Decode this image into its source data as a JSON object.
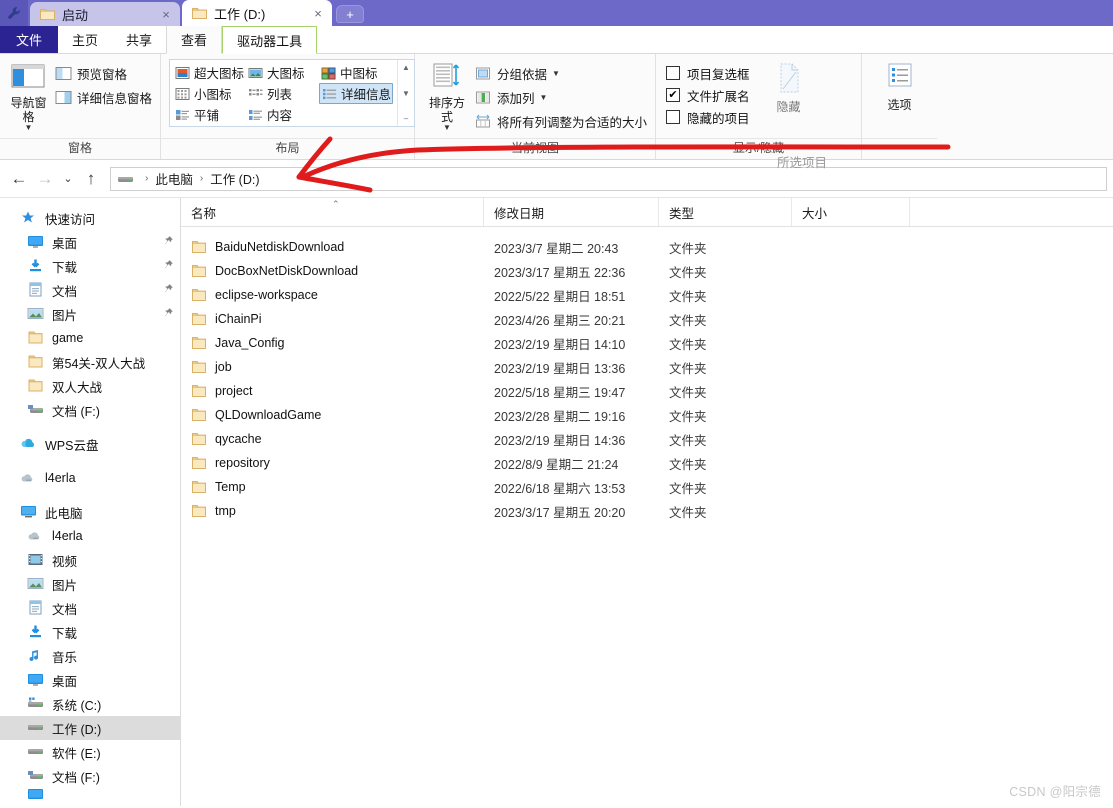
{
  "window": {
    "tabs": [
      {
        "label": "启动",
        "active": false,
        "icon": "folder-icon",
        "close": "×"
      },
      {
        "label": "工作 (D:)",
        "active": true,
        "icon": "folder-icon",
        "close": "×"
      }
    ],
    "new_tab_label": "+",
    "quick_access_icon": "wrench-icon"
  },
  "ribbon": {
    "tabs": [
      {
        "label": "文件",
        "kind": "file"
      },
      {
        "label": "主页",
        "kind": "normal"
      },
      {
        "label": "共享",
        "kind": "normal"
      },
      {
        "label": "查看",
        "kind": "selected"
      },
      {
        "label": "驱动器工具",
        "kind": "contextual"
      }
    ],
    "groups": [
      {
        "name": "窗格",
        "label": "窗格",
        "big_button": {
          "label": "导航窗格",
          "icon": "nav-pane-icon",
          "has_caret": true
        },
        "items": [
          {
            "label": "预览窗格",
            "icon": "preview-pane-icon"
          },
          {
            "label": "详细信息窗格",
            "icon": "details-pane-icon"
          }
        ]
      },
      {
        "name": "布局",
        "label": "布局",
        "views": [
          {
            "label": "超大图标",
            "icon": "extra-large-icons-icon",
            "selected": false
          },
          {
            "label": "大图标",
            "icon": "large-icons-icon",
            "selected": false
          },
          {
            "label": "中图标",
            "icon": "medium-icons-icon",
            "selected": false
          },
          {
            "label": "小图标",
            "icon": "small-icons-icon",
            "selected": false
          },
          {
            "label": "列表",
            "icon": "list-view-icon",
            "selected": false
          },
          {
            "label": "详细信息",
            "icon": "details-view-icon",
            "selected": true
          },
          {
            "label": "平铺",
            "icon": "tiles-view-icon",
            "selected": false
          },
          {
            "label": "内容",
            "icon": "content-view-icon",
            "selected": false
          }
        ],
        "scroll_up": "▲",
        "scroll_down": "▼",
        "scroll_more": "‒"
      },
      {
        "name": "当前视图",
        "label": "当前视图",
        "big_button": {
          "label": "排序方式",
          "icon": "sort-by-icon",
          "has_caret": true
        },
        "items": [
          {
            "label": "分组依据",
            "icon": "group-by-icon",
            "dropdown": true
          },
          {
            "label": "添加列",
            "icon": "add-columns-icon",
            "dropdown": true
          },
          {
            "label": "将所有列调整为合适的大小",
            "icon": "size-all-columns-icon",
            "dropdown": false
          }
        ]
      },
      {
        "name": "显示/隐藏",
        "label": "显示/隐藏",
        "checkboxes": [
          {
            "label": "项目复选框",
            "checked": false
          },
          {
            "label": "文件扩展名",
            "checked": true
          },
          {
            "label": "隐藏的项目",
            "checked": false
          }
        ],
        "hide_button": {
          "line1": "隐藏",
          "line2": "所选项目",
          "icon": "hide-selected-icon"
        }
      },
      {
        "name": "选项",
        "label": "",
        "big_button": {
          "label": "选项",
          "icon": "options-icon",
          "has_caret": false
        }
      }
    ]
  },
  "address": {
    "back_icon": "←",
    "forward_icon": "→",
    "recent_icon": "⌄",
    "up_icon": "↑",
    "drive_icon": "drive-icon",
    "crumbs": [
      "此电脑",
      "工作 (D:)"
    ],
    "separator": "›"
  },
  "nav_pane": {
    "sections": [
      {
        "header": {
          "label": "快速访问",
          "icon": "quick-access-star-icon",
          "level": "root"
        },
        "items": [
          {
            "label": "桌面",
            "icon": "desktop-icon",
            "pinned": true
          },
          {
            "label": "下载",
            "icon": "downloads-icon",
            "pinned": true
          },
          {
            "label": "文档",
            "icon": "documents-icon",
            "pinned": true
          },
          {
            "label": "图片",
            "icon": "pictures-icon",
            "pinned": true
          },
          {
            "label": "game",
            "icon": "folder-icon",
            "pinned": false
          },
          {
            "label": "第54关-双人大战",
            "icon": "folder-icon",
            "pinned": false
          },
          {
            "label": "双人大战",
            "icon": "folder-icon",
            "pinned": false
          },
          {
            "label": "文档 (F:)",
            "icon": "network-drive-icon",
            "pinned": false
          }
        ]
      },
      {
        "header": {
          "label": "WPS云盘",
          "icon": "cloud-icon",
          "level": "root"
        },
        "items": []
      },
      {
        "header": {
          "label": "l4erla",
          "icon": "onedrive-gray-icon",
          "level": "root"
        },
        "items": []
      },
      {
        "header": {
          "label": "此电脑",
          "icon": "this-pc-icon",
          "level": "root"
        },
        "items": [
          {
            "label": "l4erla",
            "icon": "onedrive-gray-icon",
            "pinned": false
          },
          {
            "label": "视频",
            "icon": "videos-icon",
            "pinned": false
          },
          {
            "label": "图片",
            "icon": "pictures-icon",
            "pinned": false
          },
          {
            "label": "文档",
            "icon": "documents-icon",
            "pinned": false
          },
          {
            "label": "下载",
            "icon": "downloads-icon",
            "pinned": false
          },
          {
            "label": "音乐",
            "icon": "music-icon",
            "pinned": false
          },
          {
            "label": "桌面",
            "icon": "desktop-icon",
            "pinned": false
          },
          {
            "label": "系统 (C:)",
            "icon": "system-drive-icon",
            "pinned": false
          },
          {
            "label": "工作 (D:)",
            "icon": "drive-icon",
            "pinned": false,
            "selected": true
          },
          {
            "label": "软件 (E:)",
            "icon": "drive-icon",
            "pinned": false
          },
          {
            "label": "文档 (F:)",
            "icon": "network-drive-icon",
            "pinned": false
          }
        ]
      }
    ]
  },
  "file_list": {
    "columns": [
      {
        "label": "名称",
        "key": "name",
        "sorted": true,
        "sort_mark": "⌃"
      },
      {
        "label": "修改日期",
        "key": "date"
      },
      {
        "label": "类型",
        "key": "type"
      },
      {
        "label": "大小",
        "key": "size"
      }
    ],
    "rows": [
      {
        "name": "BaiduNetdiskDownload",
        "date": "2023/3/7 星期二 20:43",
        "type": "文件夹",
        "size": "",
        "icon": "folder-icon"
      },
      {
        "name": "DocBoxNetDiskDownload",
        "date": "2023/3/17 星期五 22:36",
        "type": "文件夹",
        "size": "",
        "icon": "folder-icon"
      },
      {
        "name": "eclipse-workspace",
        "date": "2022/5/22 星期日 18:51",
        "type": "文件夹",
        "size": "",
        "icon": "folder-icon"
      },
      {
        "name": "iChainPi",
        "date": "2023/4/26 星期三 20:21",
        "type": "文件夹",
        "size": "",
        "icon": "folder-icon"
      },
      {
        "name": "Java_Config",
        "date": "2023/2/19 星期日 14:10",
        "type": "文件夹",
        "size": "",
        "icon": "folder-icon"
      },
      {
        "name": "job",
        "date": "2023/2/19 星期日 13:36",
        "type": "文件夹",
        "size": "",
        "icon": "folder-icon"
      },
      {
        "name": "project",
        "date": "2022/5/18 星期三 19:47",
        "type": "文件夹",
        "size": "",
        "icon": "folder-icon"
      },
      {
        "name": "QLDownloadGame",
        "date": "2023/2/28 星期二 19:16",
        "type": "文件夹",
        "size": "",
        "icon": "folder-icon"
      },
      {
        "name": "qycache",
        "date": "2023/2/19 星期日 14:36",
        "type": "文件夹",
        "size": "",
        "icon": "folder-icon"
      },
      {
        "name": "repository",
        "date": "2022/8/9 星期二 21:24",
        "type": "文件夹",
        "size": "",
        "icon": "folder-icon"
      },
      {
        "name": "Temp",
        "date": "2022/6/18 星期六 13:53",
        "type": "文件夹",
        "size": "",
        "icon": "folder-icon"
      },
      {
        "name": "tmp",
        "date": "2023/3/17 星期五 20:20",
        "type": "文件夹",
        "size": "",
        "icon": "folder-icon"
      }
    ]
  },
  "annotation": {
    "color": "#e01b1b",
    "shape": "arrow-pointing-left"
  },
  "watermark": "CSDN @阳宗德",
  "colors": {
    "titlebar": "#6c69c9",
    "file_tab": "#2b2391",
    "contextual_tab_border": "#a5d46a",
    "selection": "#dcdcdc",
    "folder": "#f6d68a"
  }
}
